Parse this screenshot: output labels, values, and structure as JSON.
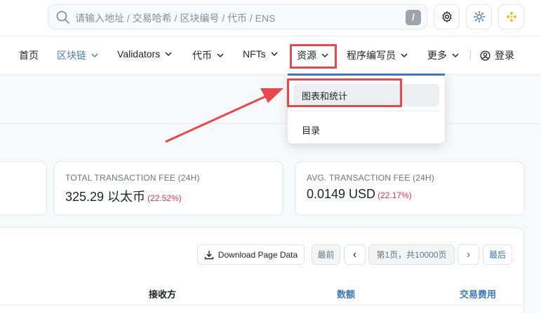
{
  "search": {
    "placeholder": "请输入地址 / 交易哈希 / 区块编号 / 代币 / ENS",
    "shortcut": "/",
    "icon": "search-icon"
  },
  "toolbar": {
    "settings_icon": "gear-icon",
    "theme_icon": "sun-icon",
    "network_icon": "bnb-logo-icon"
  },
  "nav": {
    "items": [
      {
        "label": "首页"
      },
      {
        "label": "区块链"
      },
      {
        "label": "Validators"
      },
      {
        "label": "代币"
      },
      {
        "label": "NFTs"
      },
      {
        "label": "资源"
      },
      {
        "label": "程序编写员"
      },
      {
        "label": "更多"
      }
    ],
    "login": "登录"
  },
  "dropdown": {
    "items": [
      {
        "label": "图表和统计"
      },
      {
        "label": "目录"
      }
    ]
  },
  "cards": [
    {
      "label": "TOTAL TRANSACTION FEE (24H)",
      "value": "325.29 以太币",
      "change": "(22.52%)"
    },
    {
      "label": "AVG. TRANSACTION FEE (24H)",
      "value": "0.0149 USD",
      "change": "(22.17%)"
    }
  ],
  "pagination": {
    "download": "Download Page Data",
    "first": "最前",
    "prev": "‹",
    "page_info": "第1页，共10000页",
    "next": "›",
    "last": "最后"
  },
  "table": {
    "headers": {
      "receiver": "接收方",
      "amount": "数额",
      "fee": "交易费用"
    }
  },
  "colors": {
    "accent": "#3f78b8",
    "highlight": "#e8484c",
    "negative": "#dc3545",
    "bnb": "#f0b90b"
  }
}
